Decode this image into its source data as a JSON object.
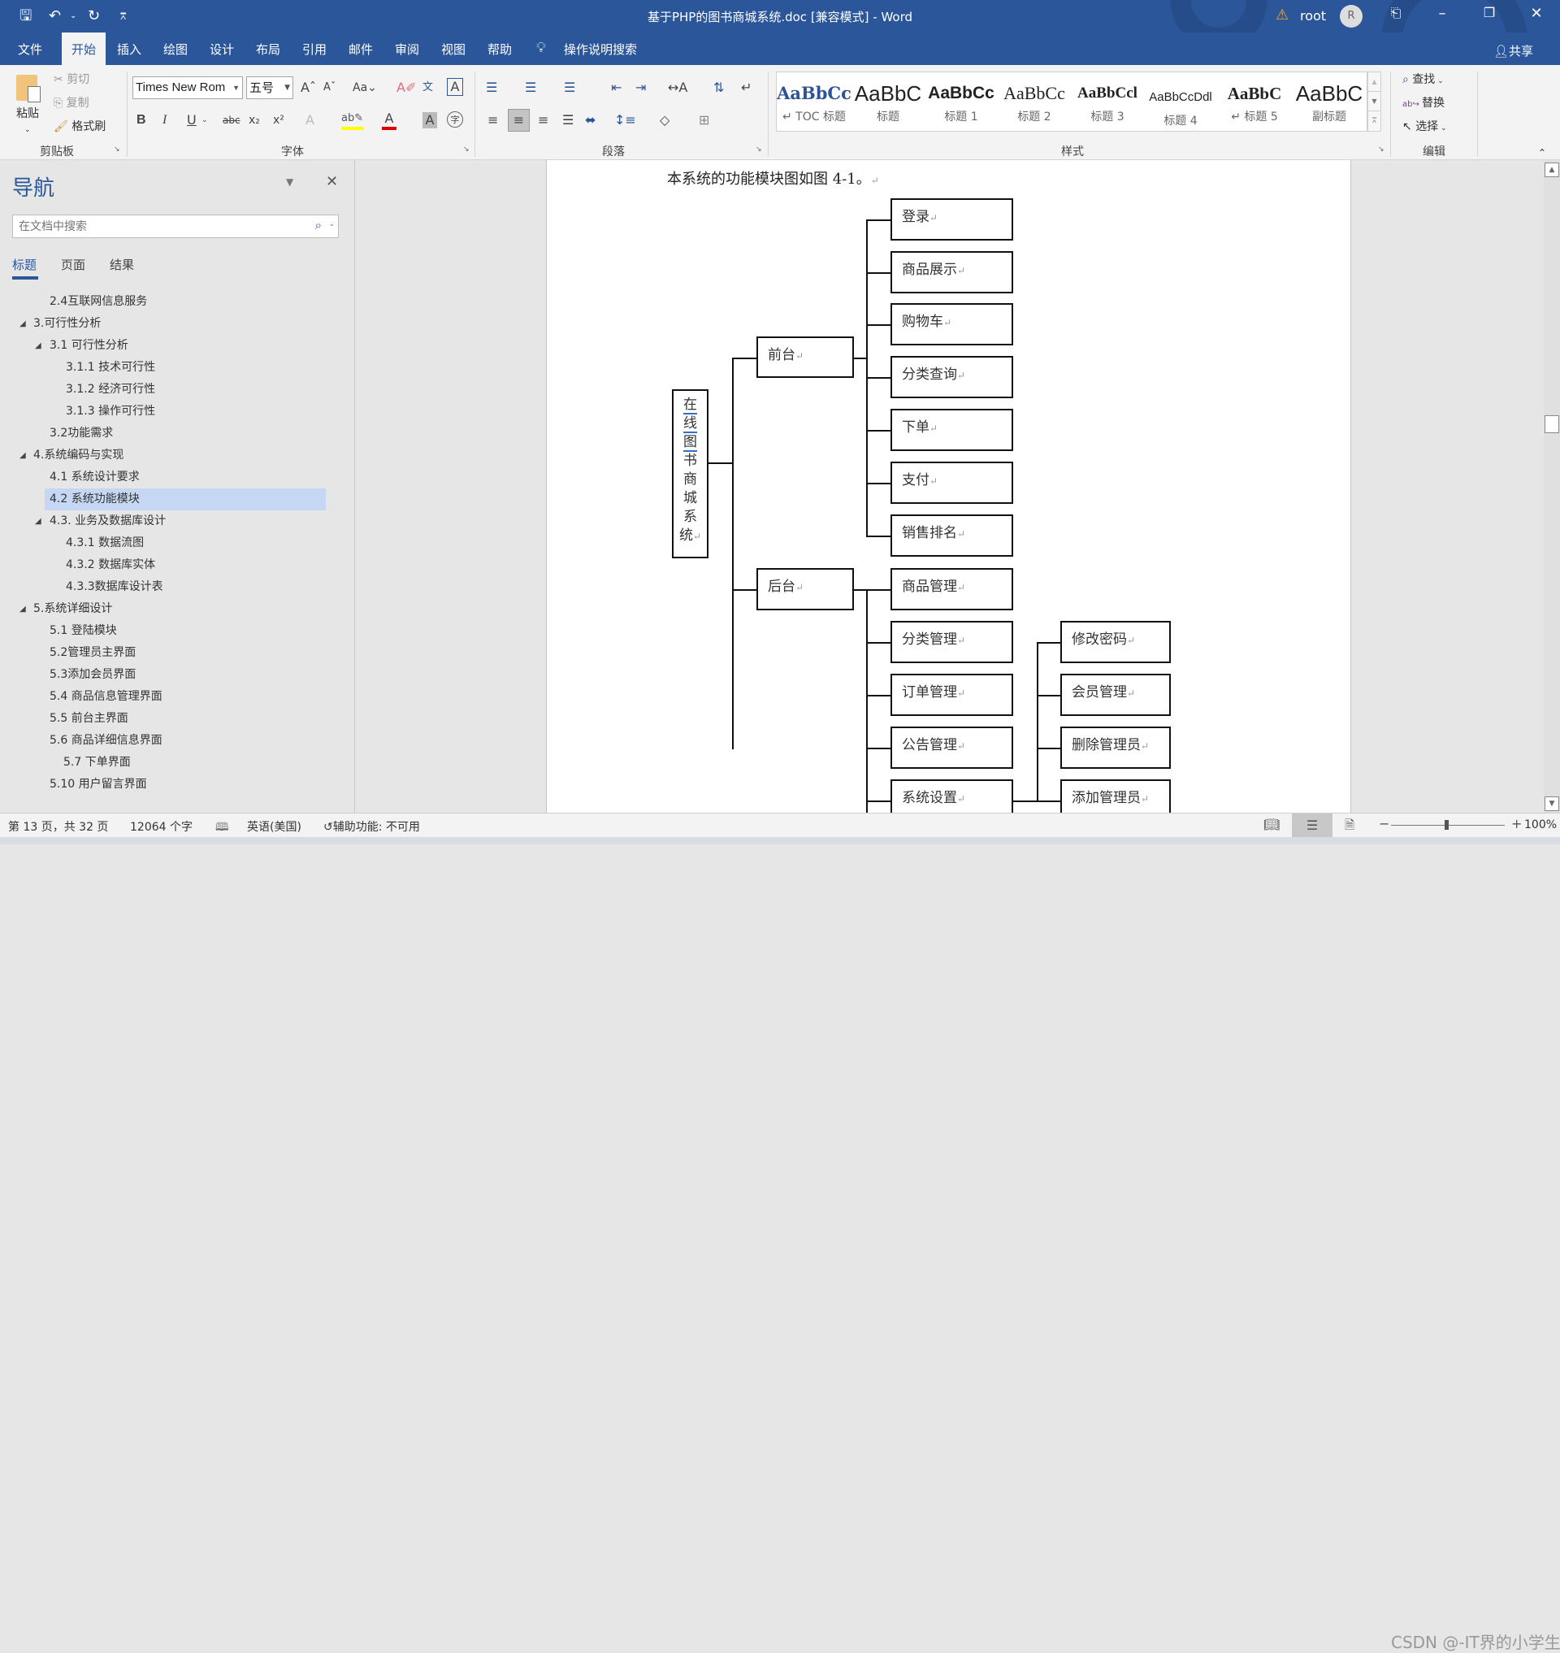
{
  "titlebar": {
    "title": "基于PHP的图书商城系统.doc [兼容模式]  -  Word",
    "user": "root",
    "avatar_initial": "R",
    "qat": {
      "save": "save-icon",
      "undo": "undo-icon",
      "redo": "redo-icon",
      "customize": "customize-icon"
    }
  },
  "ribbon_tabs": [
    "文件",
    "开始",
    "插入",
    "绘图",
    "设计",
    "布局",
    "引用",
    "邮件",
    "审阅",
    "视图",
    "帮助"
  ],
  "active_tab": "开始",
  "tell_me": "操作说明搜索",
  "share": "共享",
  "clipboard": {
    "paste": "粘贴",
    "cut": "剪切",
    "copy": "复制",
    "format_painter": "格式刷",
    "label": "剪贴板"
  },
  "font": {
    "name": "Times New Rom",
    "size": "五号",
    "label": "字体",
    "highlight_color": "#ffff00",
    "font_color": "#ff0000"
  },
  "paragraph": {
    "label": "段落"
  },
  "styles": {
    "label": "样式",
    "items": [
      {
        "sample": "AaBbCc",
        "name": "↵ TOC 标题"
      },
      {
        "sample": "AaBbC",
        "name": "标题"
      },
      {
        "sample": "AaBbCc",
        "name": "标题 1"
      },
      {
        "sample": "AaBbCc",
        "name": "标题 2"
      },
      {
        "sample": "AaBbCcl",
        "name": "标题 3"
      },
      {
        "sample": "AaBbCcDdl",
        "name": "标题 4"
      },
      {
        "sample": "AaBbC",
        "name": "↵ 标题 5"
      },
      {
        "sample": "AaBbC",
        "name": "副标题"
      }
    ]
  },
  "editing": {
    "find": "查找",
    "replace": "替换",
    "select": "选择",
    "label": "编辑"
  },
  "nav": {
    "title": "导航",
    "search_placeholder": "在文档中搜索",
    "tabs": [
      "标题",
      "页面",
      "结果"
    ],
    "items": [
      {
        "label": "2.4互联网信息服务",
        "level": 2,
        "expanded": null
      },
      {
        "label": "3.可行性分析",
        "level": 1,
        "expanded": true
      },
      {
        "label": "3.1 可行性分析",
        "level": 2,
        "expanded": true
      },
      {
        "label": "3.1.1 技术可行性",
        "level": 3,
        "expanded": null
      },
      {
        "label": "3.1.2 经济可行性",
        "level": 3,
        "expanded": null
      },
      {
        "label": "3.1.3 操作可行性",
        "level": 3,
        "expanded": null
      },
      {
        "label": "3.2功能需求",
        "level": 2,
        "expanded": null
      },
      {
        "label": "4.系统编码与实现",
        "level": 1,
        "expanded": true
      },
      {
        "label": "4.1 系统设计要求",
        "level": 2,
        "expanded": null
      },
      {
        "label": "4.2 系统功能模块",
        "level": 2,
        "expanded": null,
        "selected": true
      },
      {
        "label": "4.3. 业务及数据库设计",
        "level": 2,
        "expanded": true
      },
      {
        "label": "4.3.1 数据流图",
        "level": 3,
        "expanded": null
      },
      {
        "label": "4.3.2 数据库实体",
        "level": 3,
        "expanded": null
      },
      {
        "label": "4.3.3数据库设计表",
        "level": 3,
        "expanded": null
      },
      {
        "label": "5.系统详细设计",
        "level": 1,
        "expanded": true
      },
      {
        "label": "5.1 登陆模块",
        "level": 2,
        "expanded": null
      },
      {
        "label": "5.2管理员主界面",
        "level": 2,
        "expanded": null
      },
      {
        "label": "5.3添加会员界面",
        "level": 2,
        "expanded": null
      },
      {
        "label": "5.4 商品信息管理界面",
        "level": 2,
        "expanded": null
      },
      {
        "label": "5.5 前台主界面",
        "level": 2,
        "expanded": null
      },
      {
        "label": "5.6 商品详细信息界面",
        "level": 2,
        "expanded": null
      },
      {
        "label": "5.7 下单界面",
        "level": 2.5,
        "expanded": null
      },
      {
        "label": "5.10 用户留言界面",
        "level": 2,
        "expanded": null
      }
    ]
  },
  "document": {
    "intro": "本系统的功能模块图如图 4-1。",
    "diagram": {
      "root": "在线图书商城系统",
      "front": {
        "label": "前台",
        "children": [
          "登录",
          "商品展示",
          "购物车",
          "分类查询",
          "下单",
          "支付",
          "销售排名"
        ]
      },
      "back": {
        "label": "后台",
        "children": [
          "商品管理",
          "分类管理",
          "订单管理",
          "公告管理",
          "系统设置"
        ],
        "settings_children": [
          "修改密码",
          "会员管理",
          "删除管理员",
          "添加管理员"
        ]
      }
    }
  },
  "status": {
    "page": "第 13 页，共 32 页",
    "words": "12064 个字",
    "language": "英语(美国)",
    "accessibility": "辅助功能: 不可用",
    "zoom": "100%",
    "watermark": "CSDN @-IT界的小学生"
  }
}
